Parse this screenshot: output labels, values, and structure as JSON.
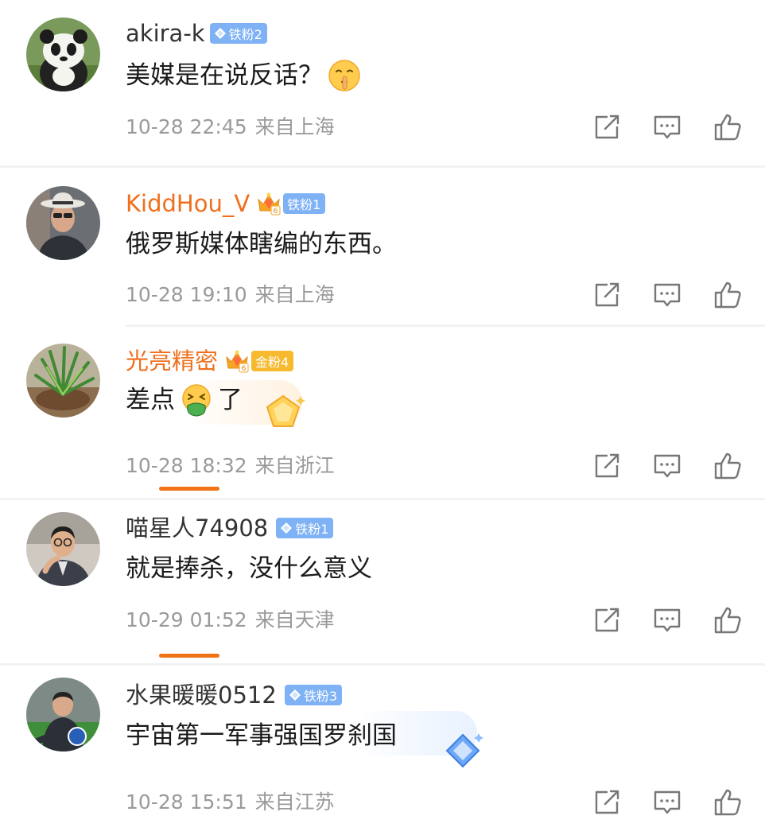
{
  "comments": [
    {
      "username": "akira-k",
      "name_color": "normal",
      "crown": false,
      "badge": {
        "label": "铁粉2",
        "type": "iron"
      },
      "text_parts": [
        "美媒是在说反话？"
      ],
      "emoji": "shushing-face-emoji",
      "time": "10-28 22:45",
      "location": "来自上海",
      "avatar": "panda"
    },
    {
      "username": "KiddHou_V",
      "name_color": "orange",
      "crown": true,
      "badge": {
        "label": "铁粉1",
        "type": "iron"
      },
      "text_parts": [
        "俄罗斯媒体瞎编的东西。"
      ],
      "time": "10-28 19:10",
      "location": "来自上海",
      "avatar": "man-hat"
    },
    {
      "username": "光亮精密",
      "name_color": "orange",
      "crown": true,
      "badge": {
        "label": "金粉4",
        "type": "gold"
      },
      "text_parts": [
        "差点",
        "了"
      ],
      "emoji": "vomiting-face-emoji",
      "time": "10-28 18:32",
      "location": "来自浙江",
      "avatar": "plant"
    },
    {
      "username": "喵星人74908",
      "name_color": "normal",
      "crown": false,
      "badge": {
        "label": "铁粉1",
        "type": "iron"
      },
      "text_parts": [
        "就是捧杀，没什么意义"
      ],
      "time": "10-29 01:52",
      "location": "来自天津",
      "avatar": "man-glasses"
    },
    {
      "username": "水果暖暖0512",
      "name_color": "normal",
      "crown": false,
      "badge": {
        "label": "铁粉3",
        "type": "iron"
      },
      "text_parts": [
        "宇宙第一军事强国罗刹国"
      ],
      "time": "10-28 15:51",
      "location": "来自江苏",
      "avatar": "man-field"
    }
  ],
  "colors": {
    "orange_name": "#f06e1c",
    "meta_gray": "#9a9a9a",
    "iron_badge": "#7fb2f5",
    "gold_badge": "#f7b92d",
    "tab_indicator": "#f07318"
  }
}
